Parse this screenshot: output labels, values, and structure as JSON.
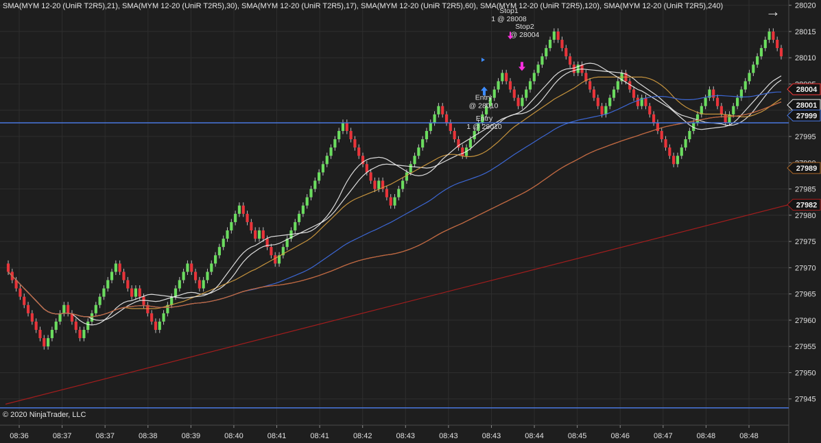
{
  "legend_text": "SMA(MYM 12-20 (UniR T2R5),21), SMA(MYM 12-20 (UniR T2R5),30), SMA(MYM 12-20 (UniR T2R5),17), SMA(MYM 12-20 (UniR T2R5),60), SMA(MYM 12-20 (UniR T2R5),120), SMA(MYM 12-20 (UniR T2R5),240)",
  "copyright": "© 2020 NinjaTrader, LLC",
  "colors": {
    "background": "#1e1e1e",
    "grid": "#2e2e2e",
    "bull": "#6bdc5f",
    "bear": "#e8343a",
    "wick": "#bdbdbd",
    "hline": "#4a78e0",
    "text": "#e0e0e0"
  },
  "chart_data": {
    "type": "candlestick",
    "ylim": [
      27940,
      28021
    ],
    "y_ticks": [
      27945,
      27950,
      27955,
      27960,
      27965,
      27970,
      27975,
      27980,
      27985,
      27990,
      27995,
      28000,
      28005,
      28010,
      28015,
      28020
    ],
    "x_ticks": [
      "08:36",
      "08:37",
      "08:37",
      "08:38",
      "08:39",
      "08:40",
      "08:41",
      "08:41",
      "08:42",
      "08:43",
      "08:43",
      "08:43",
      "08:44",
      "08:45",
      "08:46",
      "08:47",
      "08:48",
      "08:48"
    ],
    "candle_dirs": "DDDDDDDDDDUUUUUDDDDUUUUUUUUUDDDDUDDDDDUUUUUUUUDDDUUUUUUUUUUDDDDUDDDDUUUUUUUUUUUUUUUUUDDDDDDDDUDDDUUUUUUUUUUUUDDDDDDUUUUUUUUUU",
    "candle_dirs_tail": "DDDDUUUUUUUUUDDDDDUDDDDDDUUUUUDDDDUDDDDDDDDUUUUUUUUUDDDDUUUUUUUUUUUDDD",
    "start_price": 27975,
    "brick_size": 2,
    "horizontal_lines": [
      27997.6,
      27943.3
    ],
    "price_labels": [
      {
        "value": 28004,
        "text": "28004",
        "color": "#ff3b3b"
      },
      {
        "value": 28001,
        "text": "28001",
        "color": "#f0f0f0"
      },
      {
        "value": 27999,
        "text": "27999",
        "color": "#4a78e0"
      },
      {
        "value": 27989,
        "text": "27989",
        "color": "#b06a2a"
      },
      {
        "value": 27982,
        "text": "27982",
        "color": "#a31d1d"
      }
    ],
    "series": [
      {
        "name": "SMA 21",
        "color": "#f2f2f2",
        "period": 21
      },
      {
        "name": "SMA 30",
        "color": "#d8a040",
        "period": 30
      },
      {
        "name": "SMA 17",
        "color": "#f2f2f2",
        "period": 17
      },
      {
        "name": "SMA 60",
        "color": "#3f6fe8",
        "period": 60
      },
      {
        "name": "SMA 120",
        "color": "#ff70b8",
        "period": 120
      },
      {
        "name": "SMA 240",
        "color": "#b86a2a",
        "period": 240
      }
    ],
    "annotations": [
      {
        "label": "Stop1",
        "sub": "1 @ 28008",
        "price": 28018.5
      },
      {
        "label": "Stop2",
        "sub": "@ 28004",
        "price": 28015.5
      },
      {
        "label": "Entry",
        "sub": "@ 28010",
        "price": 28002
      },
      {
        "label": "Entry",
        "sub": "1 @ 28010",
        "price": 27998
      }
    ]
  }
}
